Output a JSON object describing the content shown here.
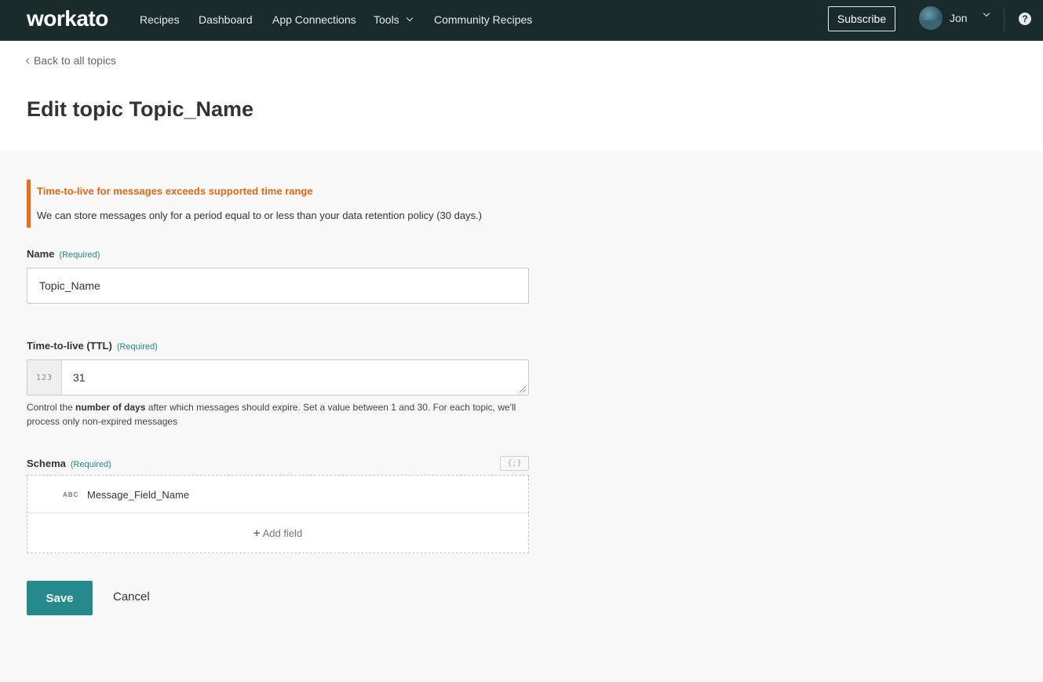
{
  "nav": {
    "logo": "workato",
    "links": [
      "Recipes",
      "Dashboard",
      "App Connections",
      "Tools",
      "Community Recipes"
    ],
    "subscribe": "Subscribe",
    "user": "Jon",
    "help": "?"
  },
  "header": {
    "back_link": "Back to all topics",
    "title": "Edit topic Topic_Name"
  },
  "alert": {
    "title": "Time-to-live for messages exceeds supported time range",
    "body": "We can store messages only for a period equal to or less than your data retention policy (30 days.)",
    "color": "#ef6c17"
  },
  "form": {
    "name": {
      "label": "Name",
      "required": "(Required)",
      "value": "Topic_Name"
    },
    "ttl": {
      "label": "Time-to-live (TTL)",
      "required": "(Required)",
      "prefix": "123",
      "value": "31",
      "help_before": "Control the ",
      "help_bold": "number of days",
      "help_after": " after which messages should expire. Set a value between 1 and 30. For each topic, we'll process only non-expired messages"
    },
    "schema": {
      "label": "Schema",
      "required": "(Required)",
      "toggle": "{;}",
      "fields": [
        {
          "type": "ABC",
          "name": "Message_Field_Name"
        }
      ],
      "add_field": "Add field"
    }
  },
  "actions": {
    "save": "Save",
    "cancel": "Cancel",
    "accent_color": "#268a8c"
  }
}
